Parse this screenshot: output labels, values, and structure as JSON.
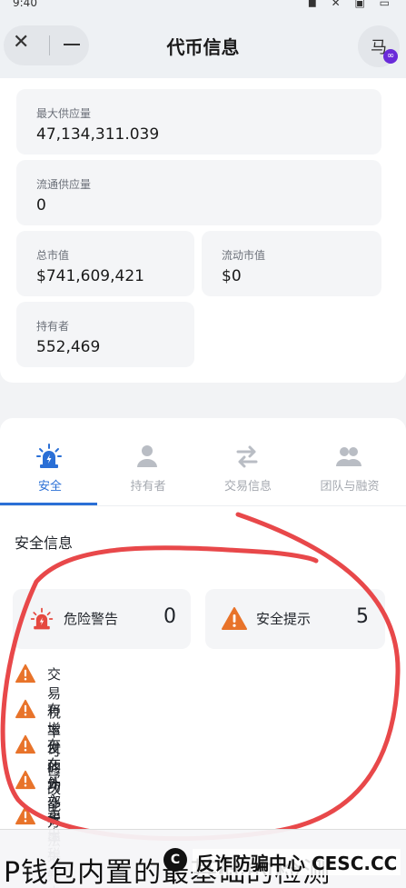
{
  "status_bar": {
    "time": "9:40",
    "icons": "◼ ✕ ▣ ▭"
  },
  "header": {
    "close_icon": "✕",
    "title": "代币信息",
    "avatar_char": "马",
    "badge_icon": "∞"
  },
  "token_stats": {
    "max_supply": {
      "label": "最大供应量",
      "value": "47,134,311.039"
    },
    "circulating_supply": {
      "label": "流通供应量",
      "value": "0"
    },
    "market_cap": {
      "label": "总市值",
      "value": "$741,609,421"
    },
    "liquidity_value": {
      "label": "流动市值",
      "value": "$0"
    },
    "holders": {
      "label": "持有者",
      "value": "552,469"
    }
  },
  "tabs": [
    {
      "label": "安全",
      "icon": "alarm-icon",
      "active": true
    },
    {
      "label": "持有者",
      "icon": "person-icon",
      "active": false
    },
    {
      "label": "交易信息",
      "icon": "swap-icon",
      "active": false
    },
    {
      "label": "团队与融资",
      "icon": "team-icon",
      "active": false
    }
  ],
  "security": {
    "section_title": "安全信息",
    "danger": {
      "label": "危险警告",
      "count": "0"
    },
    "tips": {
      "label": "安全提示",
      "count": "5"
    },
    "items": [
      "交易税率可修改",
      "有增发的功能",
      "存在外部方法",
      "买入税率未知",
      "卖出税率未知"
    ]
  },
  "footer": {
    "caption": "P钱包内置的最基础的检测",
    "watermark_logo": "C",
    "watermark": "反诈防骗中心 CESC.CC"
  },
  "colors": {
    "accent": "#2a6fd6",
    "warning": "#e8732a",
    "danger": "#e5483f",
    "annotation": "#e8484a"
  }
}
